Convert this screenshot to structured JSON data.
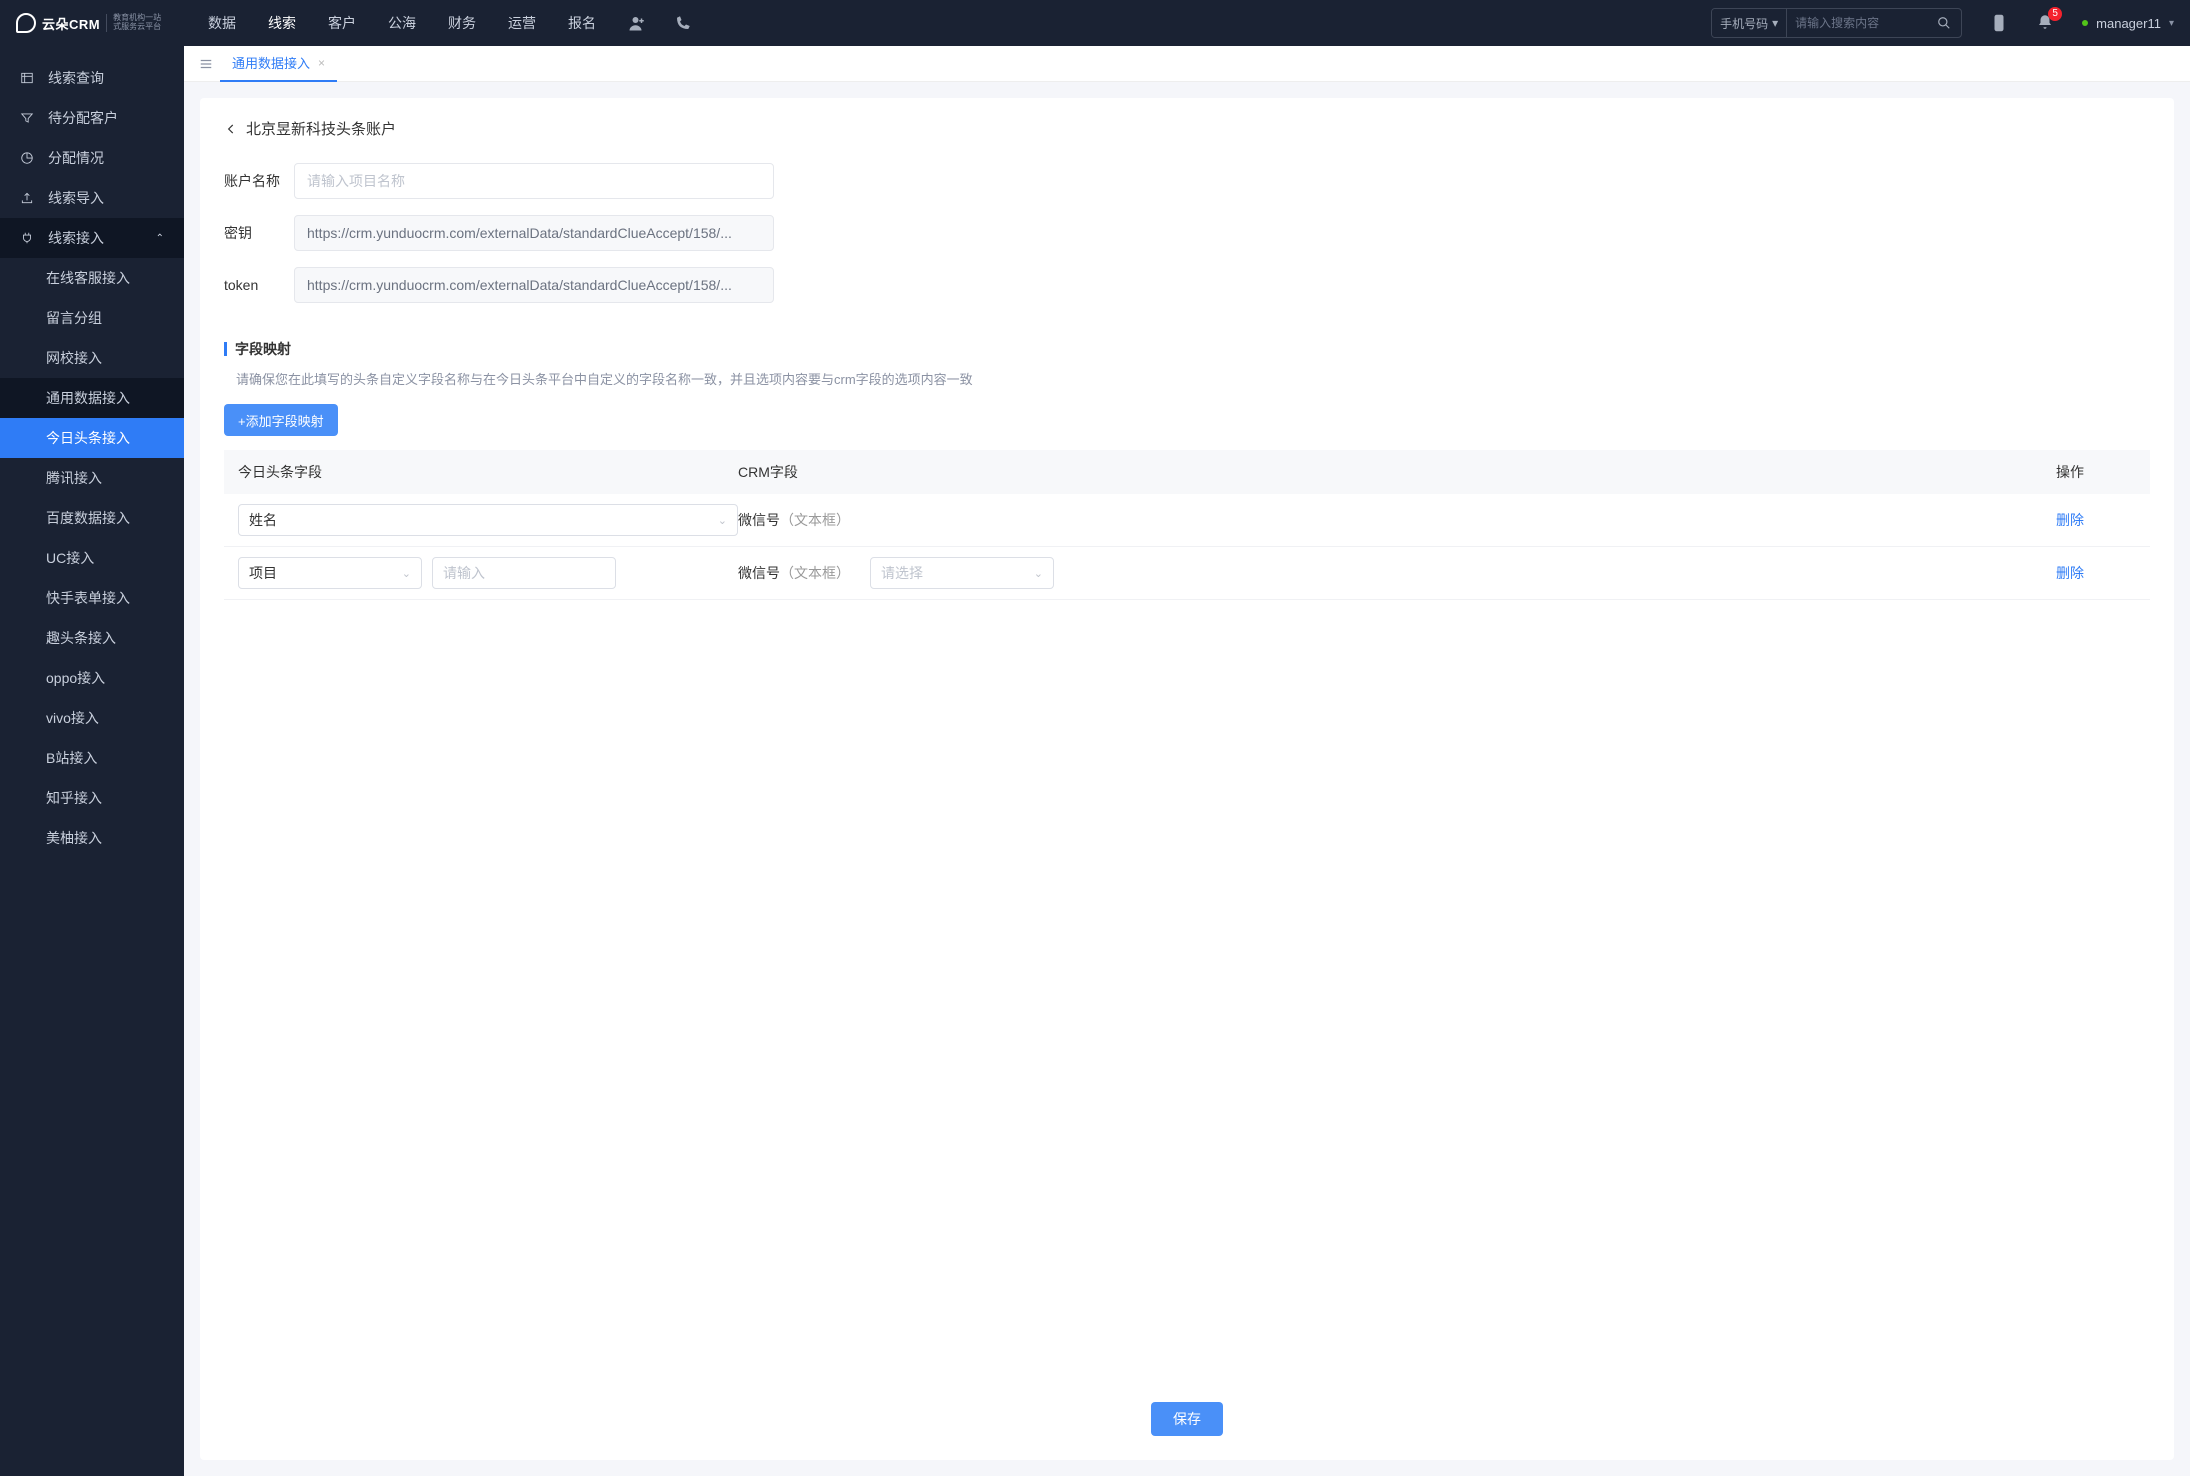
{
  "header": {
    "brand_name": "云朵CRM",
    "brand_sub1": "教育机构一站",
    "brand_sub2": "式服务云平台",
    "nav": [
      "数据",
      "线索",
      "客户",
      "公海",
      "财务",
      "运营",
      "报名"
    ],
    "nav_active_index": 1,
    "search_select": "手机号码",
    "search_placeholder": "请输入搜索内容",
    "notif_count": "5",
    "user": "manager11"
  },
  "sidebar": {
    "items": [
      {
        "label": "线索查询"
      },
      {
        "label": "待分配客户"
      },
      {
        "label": "分配情况"
      },
      {
        "label": "线索导入"
      },
      {
        "label": "线索接入",
        "expanded": true
      }
    ],
    "sub_items": [
      "在线客服接入",
      "留言分组",
      "网校接入",
      "通用数据接入",
      "今日头条接入",
      "腾讯接入",
      "百度数据接入",
      "UC接入",
      "快手表单接入",
      "趣头条接入",
      "oppo接入",
      "vivo接入",
      "B站接入",
      "知乎接入",
      "美柚接入"
    ],
    "sub_active_index": 4
  },
  "tabs": {
    "active": "通用数据接入"
  },
  "page": {
    "breadcrumb": "北京昱新科技头条账户",
    "form": {
      "account_label": "账户名称",
      "account_placeholder": "请输入项目名称",
      "secret_label": "密钥",
      "secret_value": "https://crm.yunduocrm.com/externalData/standardClueAccept/158/...",
      "token_label": "token",
      "token_value": "https://crm.yunduocrm.com/externalData/standardClueAccept/158/..."
    },
    "section_title": "字段映射",
    "section_desc": "请确保您在此填写的头条自定义字段名称与在今日头条平台中自定义的字段名称一致，并且选项内容要与crm字段的选项内容一致",
    "add_button": "+添加字段映射",
    "table": {
      "headers": [
        "今日头条字段",
        "CRM字段",
        "操作"
      ],
      "rows": [
        {
          "toutiao_select": "姓名",
          "extra_input_placeholder": "",
          "crm_label": "微信号",
          "crm_hint": "（文本框）",
          "crm_select_placeholder": "",
          "action": "删除"
        },
        {
          "toutiao_select": "项目",
          "extra_input_placeholder": "请输入",
          "crm_label": "微信号",
          "crm_hint": "（文本框）",
          "crm_select_placeholder": "请选择",
          "action": "删除"
        }
      ]
    },
    "save_button": "保存"
  }
}
